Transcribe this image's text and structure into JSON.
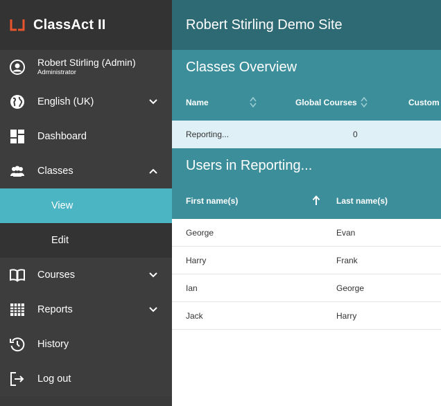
{
  "app": {
    "title": "ClassAct II"
  },
  "sidebar": {
    "user": {
      "name": "Robert Stirling (Admin)",
      "role": "Administrator"
    },
    "language": "English (UK)",
    "items": {
      "dashboard": "Dashboard",
      "classes": "Classes",
      "view": "View",
      "edit": "Edit",
      "courses": "Courses",
      "reports": "Reports",
      "history": "History",
      "logout": "Log out"
    }
  },
  "header": {
    "site_title": "Robert Stirling Demo Site"
  },
  "classes_overview": {
    "title": "Classes Overview",
    "columns": [
      "Name",
      "Global Courses",
      "Custom"
    ],
    "rows": [
      {
        "name": "Reporting...",
        "global_courses": "0"
      }
    ]
  },
  "users": {
    "title": "Users in Reporting...",
    "columns": [
      "First name(s)",
      "Last name(s)"
    ],
    "rows": [
      {
        "first": "George",
        "last": "Evan"
      },
      {
        "first": "Harry",
        "last": "Frank"
      },
      {
        "first": "Ian",
        "last": "George"
      },
      {
        "first": "Jack",
        "last": "Harry"
      }
    ]
  },
  "colors": {
    "brand_orange": "#e8542b",
    "sidebar_bg": "#3d3d3d",
    "active_item": "#4cb5c4",
    "header_bg": "#2e6a73",
    "section_bg": "#3b8e9a",
    "row_highlight": "#dff0f6"
  },
  "icons": {
    "logo": "classact-logo-icon",
    "user": "user-circle-icon",
    "language": "globe-icon",
    "dashboard": "dashboard-icon",
    "classes": "users-group-icon",
    "courses": "book-icon",
    "reports": "table-grid-icon",
    "history": "history-icon",
    "logout": "logout-icon",
    "sort": "sort-icon",
    "sorted_asc": "arrow-up-icon"
  }
}
